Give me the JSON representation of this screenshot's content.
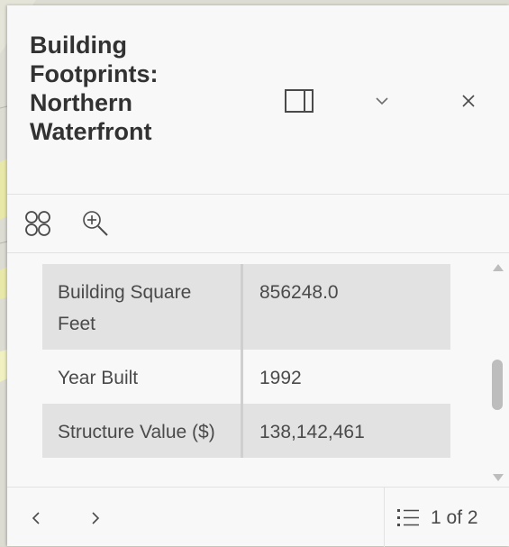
{
  "panel": {
    "title": "Building Footprints: Northern Waterfront"
  },
  "header_icons": {
    "dock": "dock-side-icon",
    "collapse": "chevron-down-icon",
    "close": "close-icon"
  },
  "toolbar_icons": {
    "select_features": "select-features-icon",
    "zoom_to": "zoom-in-icon"
  },
  "attributes": [
    {
      "label": "Building Square Feet",
      "value": "856248.0"
    },
    {
      "label": "Year Built",
      "value": "1992"
    },
    {
      "label": "Structure Value ($)",
      "value": "138,142,461"
    }
  ],
  "footer": {
    "prev_icon": "chevron-left-icon",
    "next_icon": "chevron-right-icon",
    "list_icon": "list-icon",
    "pagination": "1 of 2"
  },
  "colors": {
    "panel_bg": "#f8f8f8",
    "row_shade": "#e2e2e2",
    "text": "#323232"
  }
}
